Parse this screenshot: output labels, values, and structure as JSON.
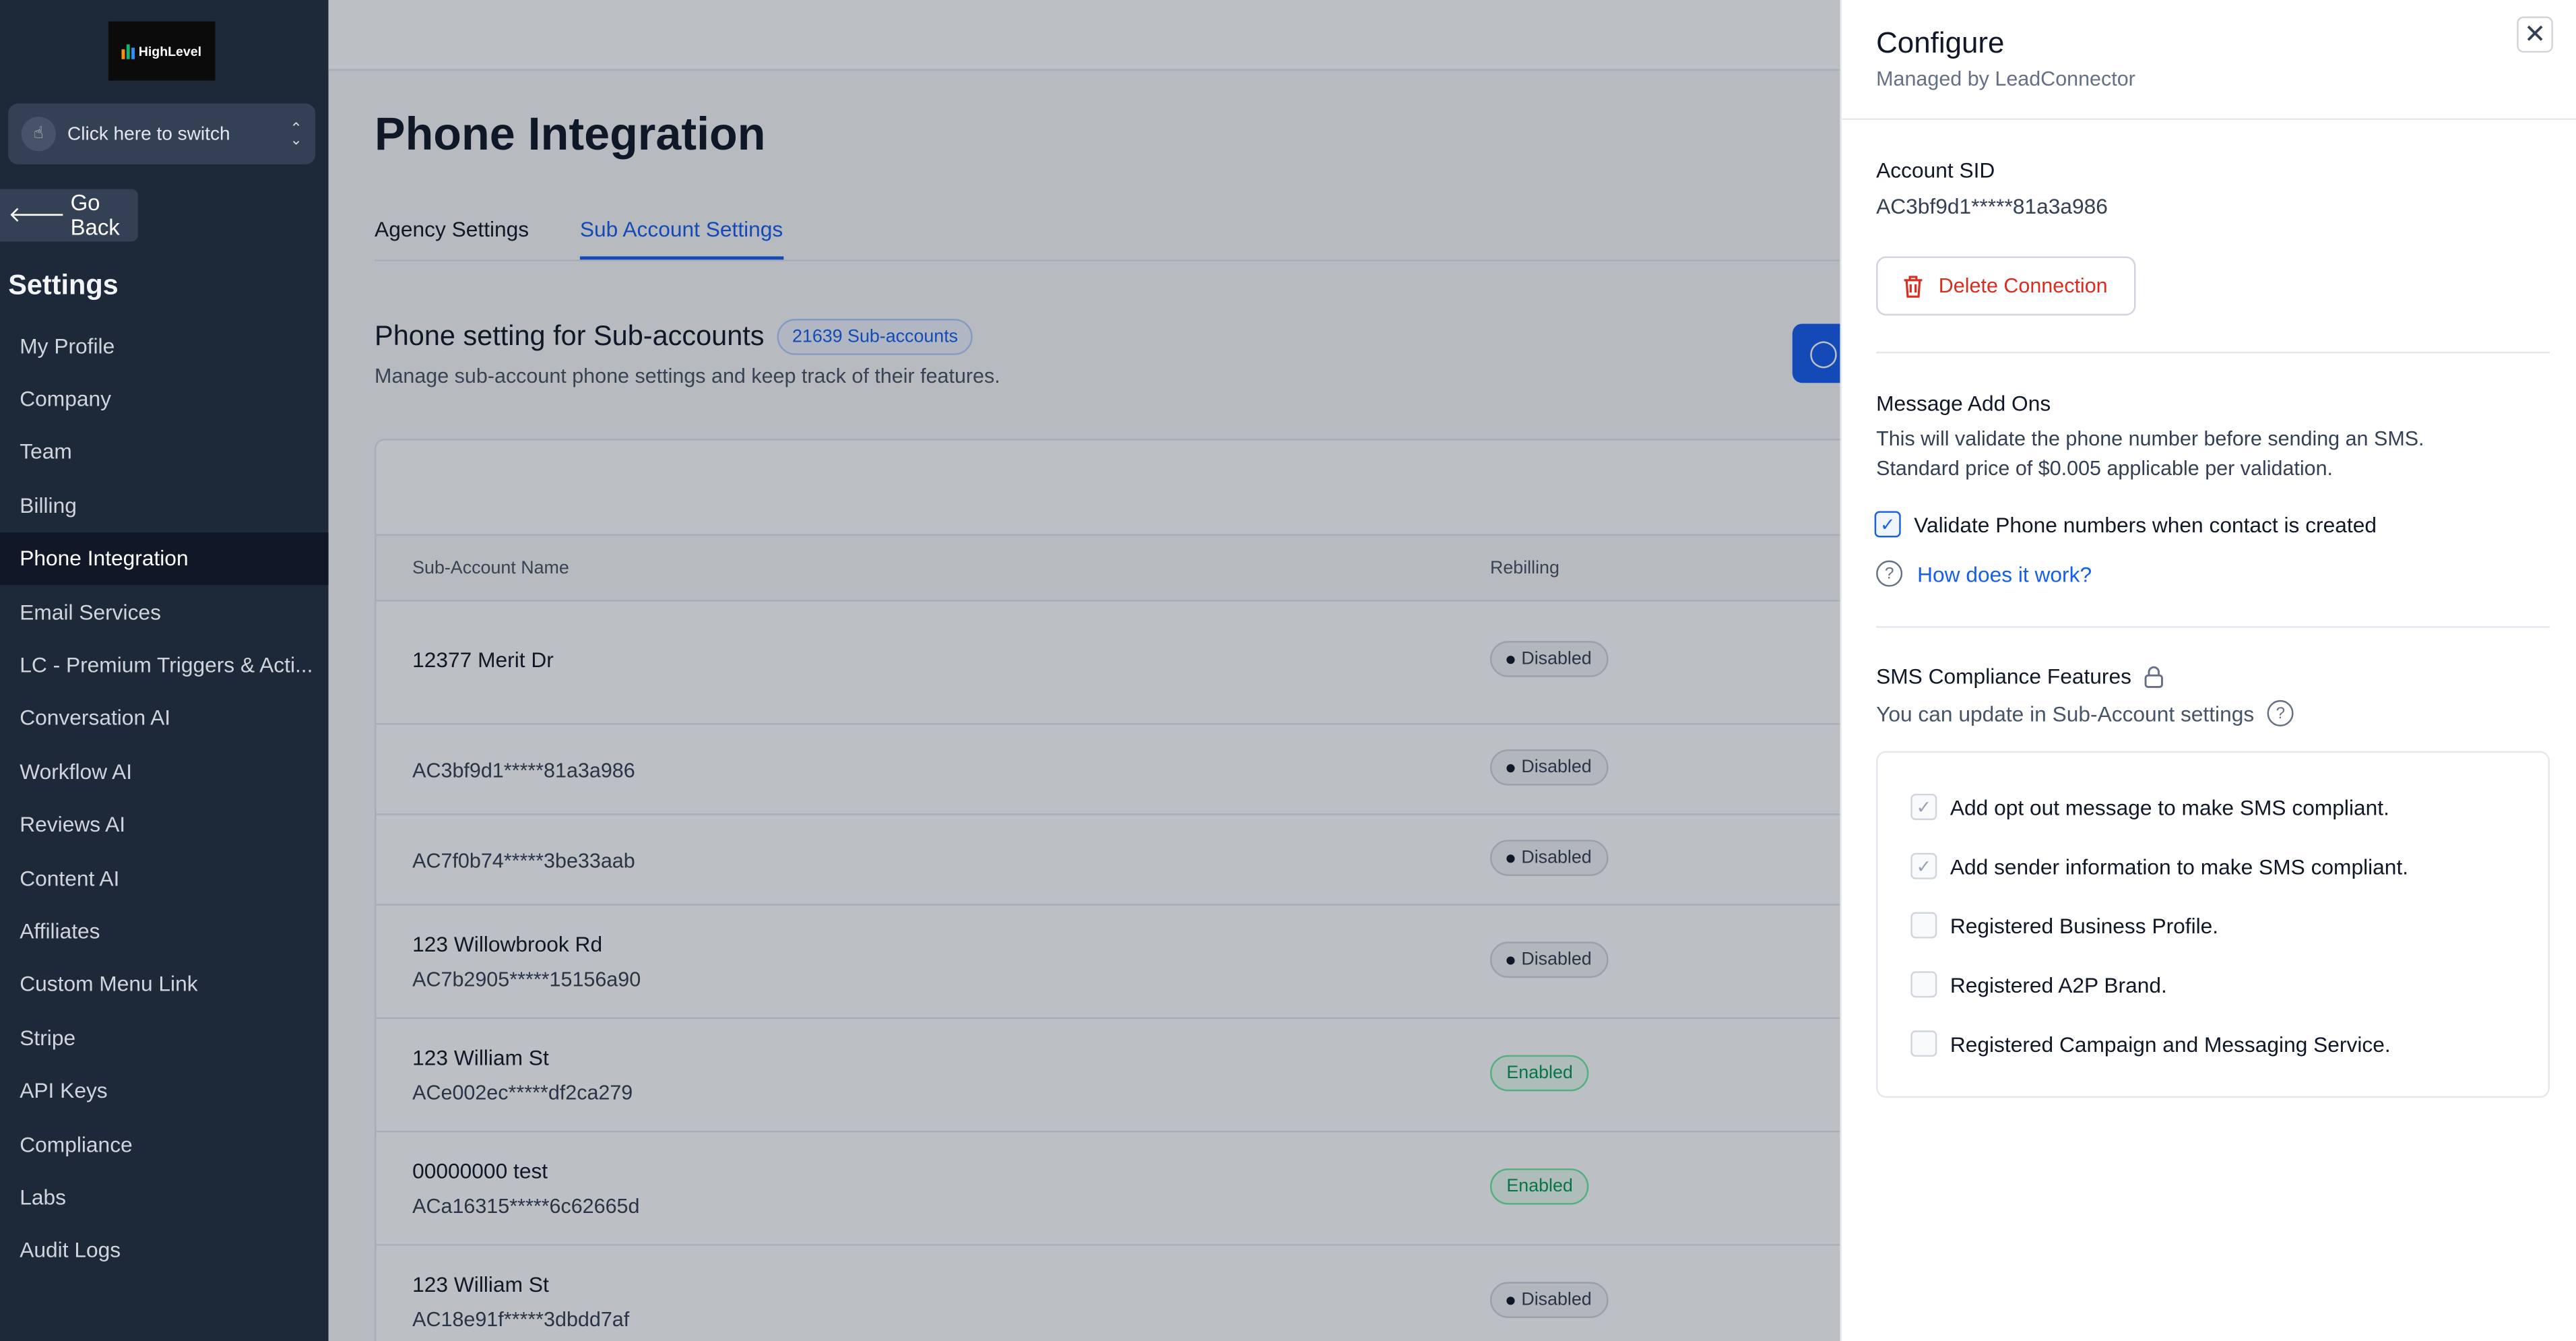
{
  "logo_text": "HighLevel",
  "switcher": {
    "label": "Click here to switch"
  },
  "go_back": "Go Back",
  "settings_title": "Settings",
  "nav": [
    {
      "label": "My Profile"
    },
    {
      "label": "Company"
    },
    {
      "label": "Team"
    },
    {
      "label": "Billing"
    },
    {
      "label": "Phone Integration",
      "active": true
    },
    {
      "label": "Email Services"
    },
    {
      "label": "LC - Premium Triggers & Acti..."
    },
    {
      "label": "Conversation AI"
    },
    {
      "label": "Workflow AI"
    },
    {
      "label": "Reviews AI"
    },
    {
      "label": "Content AI"
    },
    {
      "label": "Affiliates"
    },
    {
      "label": "Custom Menu Link"
    },
    {
      "label": "Stripe"
    },
    {
      "label": "API Keys"
    },
    {
      "label": "Compliance"
    },
    {
      "label": "Labs"
    },
    {
      "label": "Audit Logs"
    }
  ],
  "main": {
    "title": "Phone Integration",
    "tabs": [
      {
        "label": "Agency Settings"
      },
      {
        "label": "Sub Account Settings",
        "active": true
      }
    ],
    "section_title": "Phone setting for Sub-accounts",
    "count_badge": "21639 Sub-accounts",
    "section_sub": "Manage sub-account phone settings and keep track of their features.",
    "table": {
      "headers": [
        "Sub-Account Name",
        "Rebilling"
      ],
      "rows": [
        {
          "name": "12377 Merit Dr",
          "sid": "",
          "status": "Disabled"
        },
        {
          "name": "",
          "sid": "AC3bf9d1*****81a3a986",
          "status": "Disabled"
        },
        {
          "name": "",
          "sid": "AC7f0b74*****3be33aab",
          "status": "Disabled"
        },
        {
          "name": "123 Willowbrook Rd",
          "sid": "AC7b2905*****15156a90",
          "status": "Disabled"
        },
        {
          "name": "123 William St",
          "sid": "ACe002ec*****df2ca279",
          "status": "Enabled"
        },
        {
          "name": "00000000 test",
          "sid": "ACa16315*****6c62665d",
          "status": "Enabled"
        },
        {
          "name": "123 William St",
          "sid": "AC18e91f*****3dbdd7af",
          "status": "Disabled"
        }
      ]
    }
  },
  "drawer": {
    "title": "Configure",
    "subtitle": "Managed by LeadConnector",
    "account_sid_label": "Account SID",
    "account_sid_value": "AC3bf9d1*****81a3a986",
    "delete_button": "Delete Connection",
    "addons_title": "Message Add Ons",
    "addons_desc_1": "This will validate the phone number before sending an SMS.",
    "addons_desc_2": "Standard price of $0.005 applicable per validation.",
    "validate_checkbox": {
      "label": "Validate Phone numbers when contact is created",
      "checked": true
    },
    "how_link": "How does it work?",
    "compliance_title": "SMS Compliance Features",
    "compliance_sub": "You can update in Sub-Account settings",
    "compliance_items": [
      {
        "label": "Add opt out message to make SMS compliant.",
        "checked": true
      },
      {
        "label": "Add sender information to make SMS compliant.",
        "checked": true
      },
      {
        "label": "Registered Business Profile.",
        "checked": false
      },
      {
        "label": "Registered A2P Brand.",
        "checked": false
      },
      {
        "label": "Registered Campaign and Messaging Service.",
        "checked": false
      }
    ]
  },
  "colors": {
    "sidebar_bg": "#1d2939",
    "accent": "#155eef",
    "danger": "#d92d20",
    "success": "#039855"
  },
  "icons": {
    "close": "close-icon",
    "delete": "trash-icon",
    "help": "question-circle-icon",
    "lock": "lock-icon",
    "back": "arrow-left-icon",
    "switch": "pointer-icon",
    "refresh": "refresh-icon"
  }
}
